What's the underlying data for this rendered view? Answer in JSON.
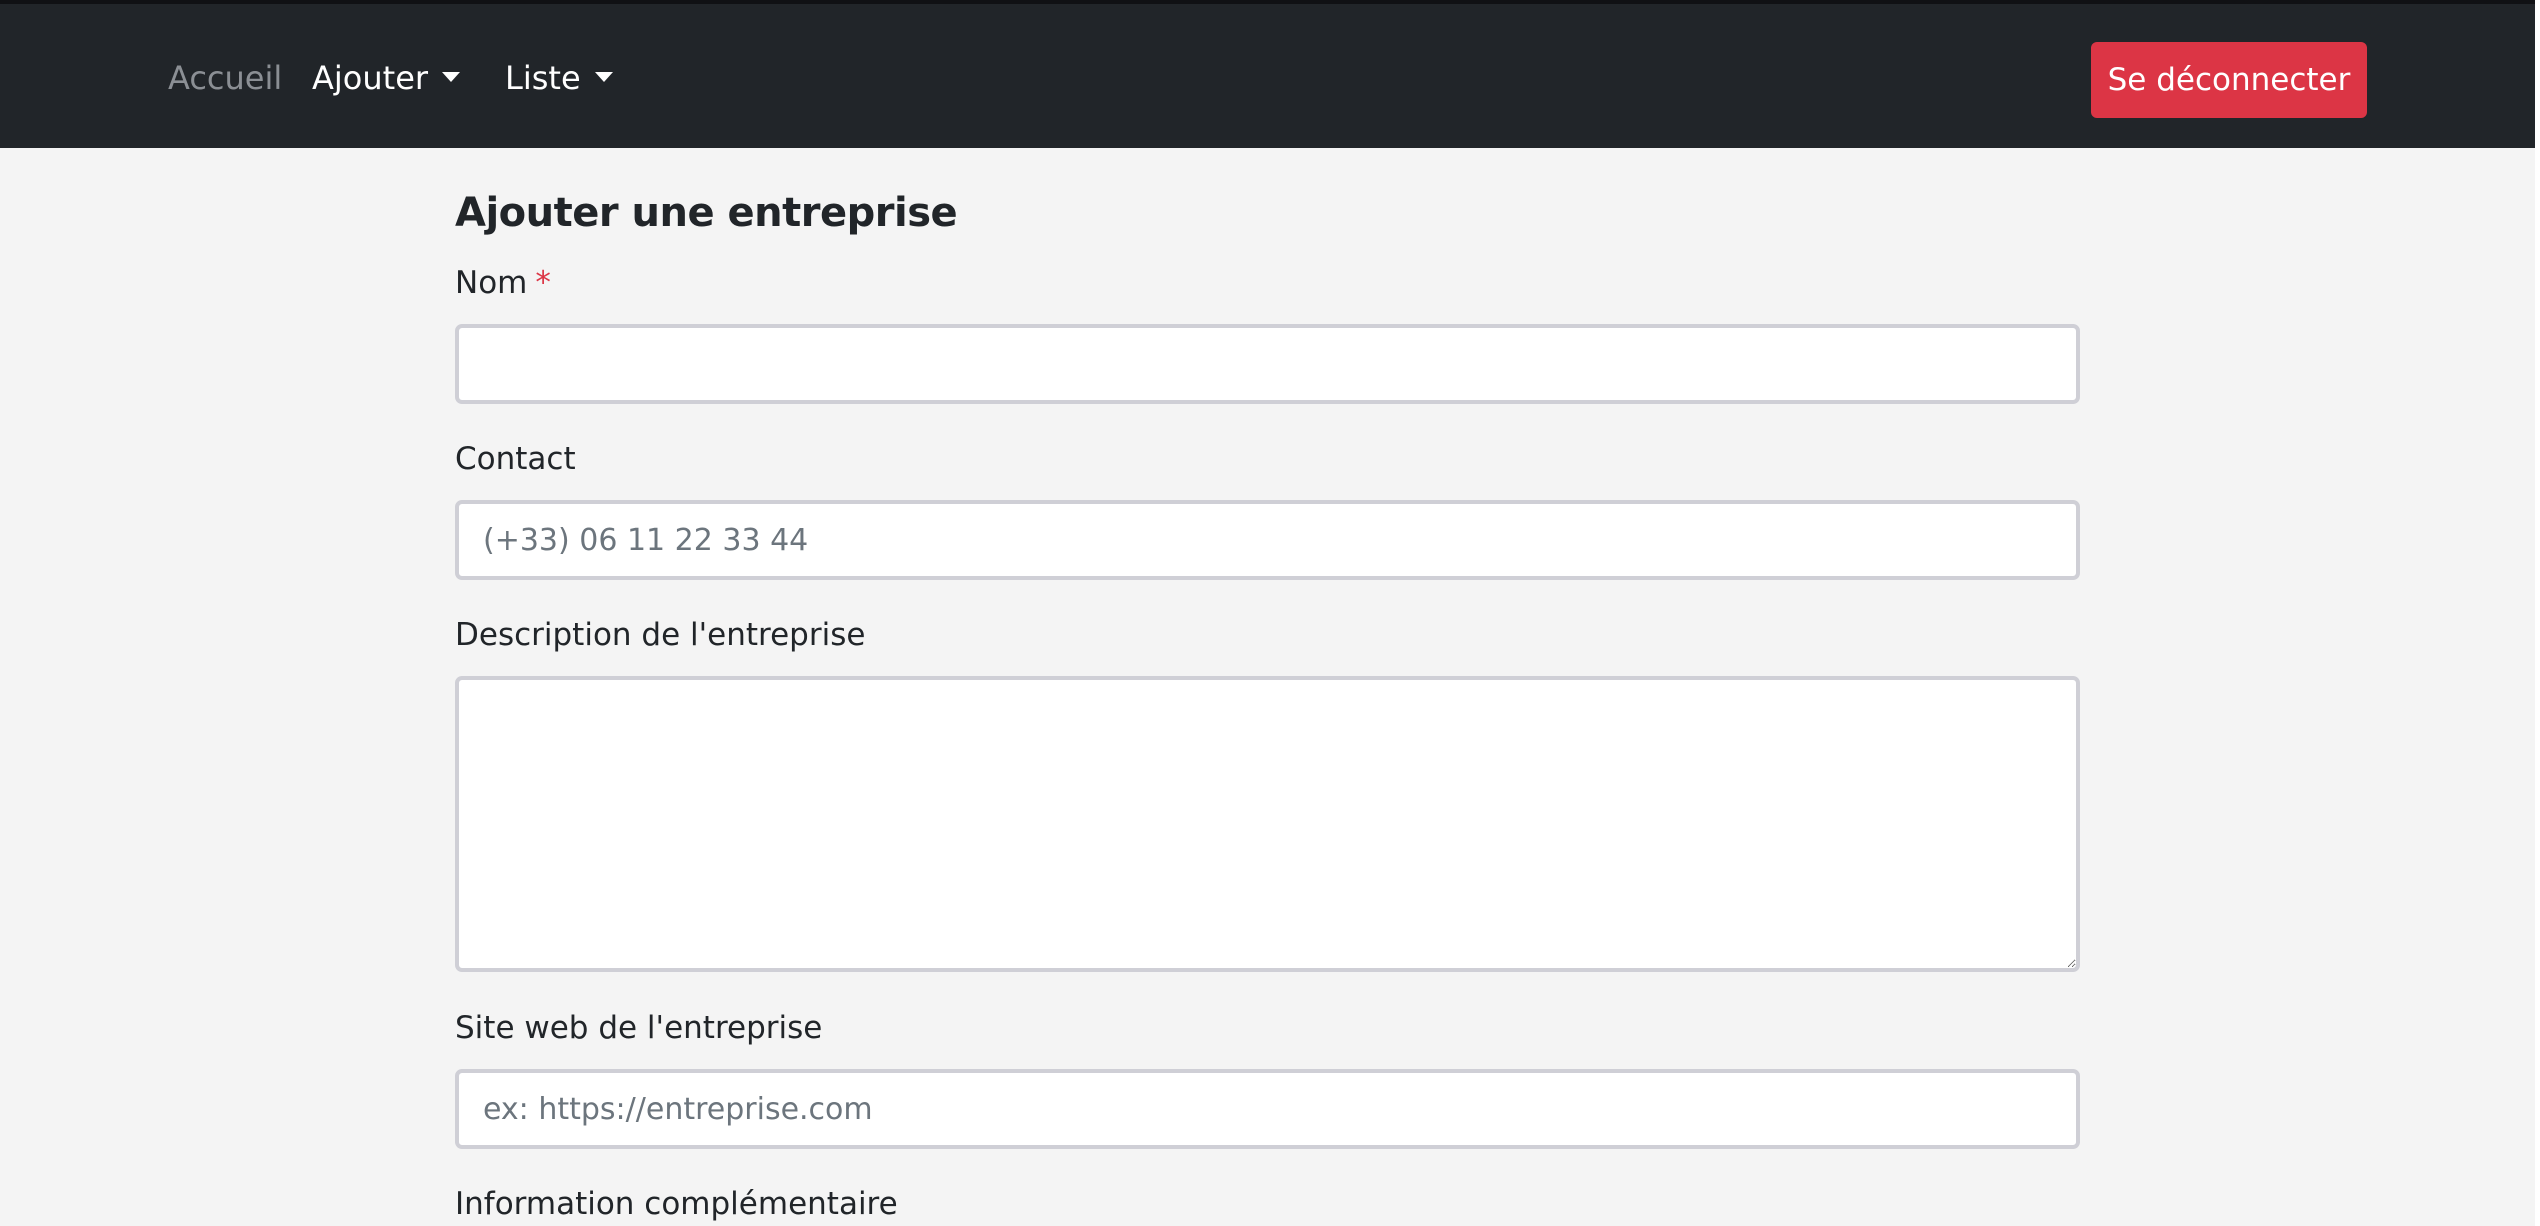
{
  "navbar": {
    "home_label": "Accueil",
    "add_label": "Ajouter",
    "list_label": "Liste",
    "logout_label": "Se déconnecter"
  },
  "form": {
    "title": "Ajouter une entreprise",
    "name_label": "Nom",
    "required_marker": "*",
    "name_value": "",
    "contact_label": "Contact",
    "contact_placeholder": "(+33) 06 11 22 33 44",
    "description_label": "Description de l'entreprise",
    "description_value": "",
    "website_label": "Site web de l'entreprise",
    "website_placeholder": "ex: https://entreprise.com",
    "extra_label": "Information complémentaire"
  },
  "colors": {
    "navbar_bg": "#212529",
    "danger": "#dc3545",
    "page_bg": "#f4f4f4"
  }
}
